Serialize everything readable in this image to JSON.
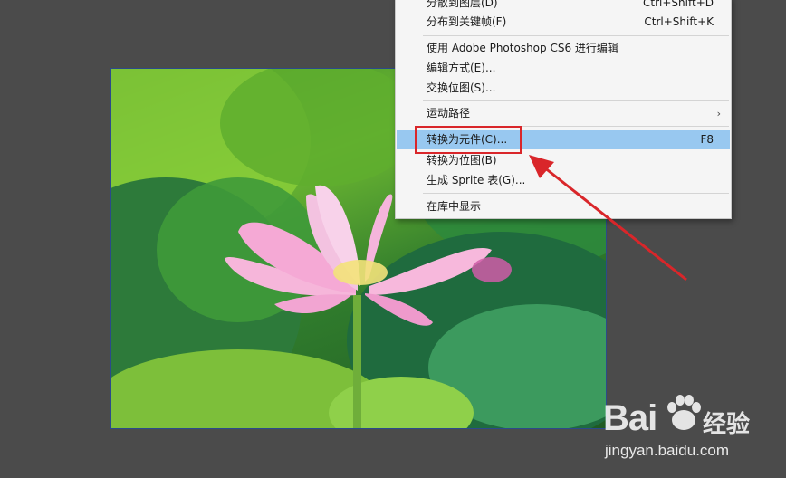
{
  "menu": {
    "items": [
      {
        "label": "分散到图层(D)",
        "shortcut": "Ctrl+Shift+D"
      },
      {
        "label": "分布到关键帧(F)",
        "shortcut": "Ctrl+Shift+K"
      },
      {
        "label": "使用 Adobe Photoshop CS6 进行编辑",
        "shortcut": ""
      },
      {
        "label": "编辑方式(E)...",
        "shortcut": ""
      },
      {
        "label": "交换位图(S)...",
        "shortcut": ""
      },
      {
        "label": "运动路径",
        "shortcut": "",
        "submenu": true
      },
      {
        "label": "转换为元件(C)...",
        "shortcut": "F8",
        "highlighted": true
      },
      {
        "label": "转换为位图(B)",
        "shortcut": ""
      },
      {
        "label": "生成 Sprite 表(G)...",
        "shortcut": ""
      },
      {
        "label": "在库中显示",
        "shortcut": ""
      }
    ],
    "submenu_glyph": "›"
  },
  "annotation": {
    "box_color": "#d9262a",
    "arrow_color": "#d9262a"
  },
  "watermark": {
    "brand": "Bai",
    "cn": "经验",
    "url": "jingyan.baidu.com"
  },
  "colors": {
    "menu_bg": "#f5f5f5",
    "highlight": "#98c8f0",
    "stage": "#4b4b4b"
  }
}
